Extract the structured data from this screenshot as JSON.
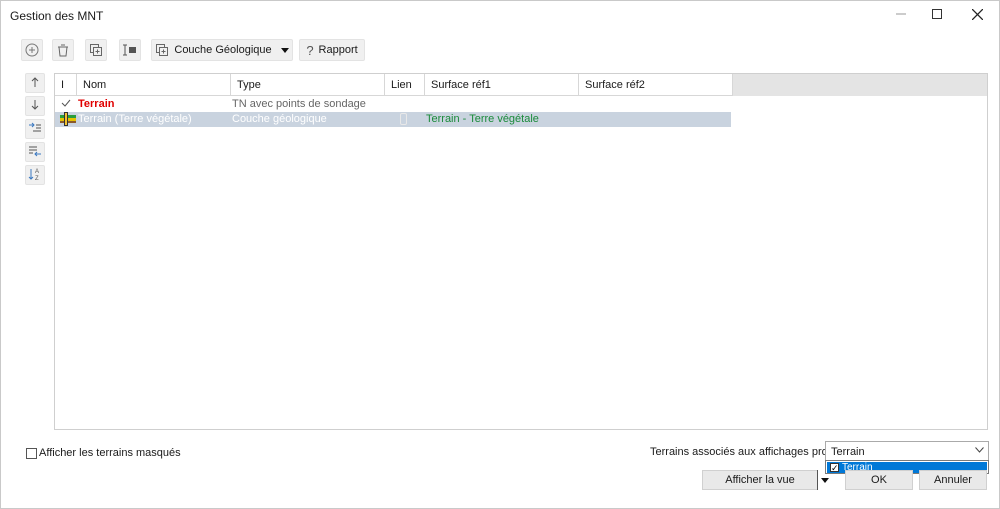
{
  "window": {
    "title": "Gestion des MNT",
    "controls": [
      "minimize-icon",
      "maximize-icon",
      "close-icon"
    ]
  },
  "toolbar": {
    "buttons": [
      {
        "name": "add",
        "icon": "plus-circle-icon"
      },
      {
        "name": "delete",
        "icon": "trash-icon"
      },
      {
        "name": "duplicate",
        "icon": "duplicate-icon"
      },
      {
        "name": "edit",
        "icon": "edit-icon"
      },
      {
        "name": "couche",
        "icon": "layer-add-icon",
        "label": "Couche Géologique"
      },
      {
        "name": "rapport",
        "icon": "question-icon",
        "label": "Rapport"
      }
    ]
  },
  "side_tools": [
    "arrow-up-icon",
    "arrow-down-icon",
    "indent-icon",
    "outdent-icon",
    "sort-az-icon"
  ],
  "grid": {
    "columns": [
      "I",
      "Nom",
      "Type",
      "Lien",
      "Surface réf1",
      "Surface réf2"
    ],
    "rows": [
      {
        "nom": "Terrain",
        "type": "TN avec points de sondage",
        "lien": "",
        "ref1": "",
        "ref2": "",
        "selected": false,
        "icon": "check-icon"
      },
      {
        "nom": "Terrain (Terre végétale)",
        "type": "Couche géologique",
        "lien": "",
        "ref1": "Terrain - Terre végétale",
        "ref2": "",
        "selected": true,
        "icon": "layer-icon"
      }
    ]
  },
  "footer": {
    "show_hidden_label": "Afficher les terrains masqués",
    "show_hidden_checked": false,
    "assoc_label": "Terrains associés aux affichages profils :",
    "assoc_value": "Terrain",
    "dropdown_item": "Terrain",
    "dropdown_item_checked": true,
    "afficher_vue": "Afficher la vue",
    "ok": "OK",
    "annuler": "Annuler"
  },
  "colors": {
    "terrain_red": "#e00000",
    "ref_green": "#1a8a3a",
    "selection": "#c9d3df",
    "dropdown_highlight": "#0078d7"
  }
}
